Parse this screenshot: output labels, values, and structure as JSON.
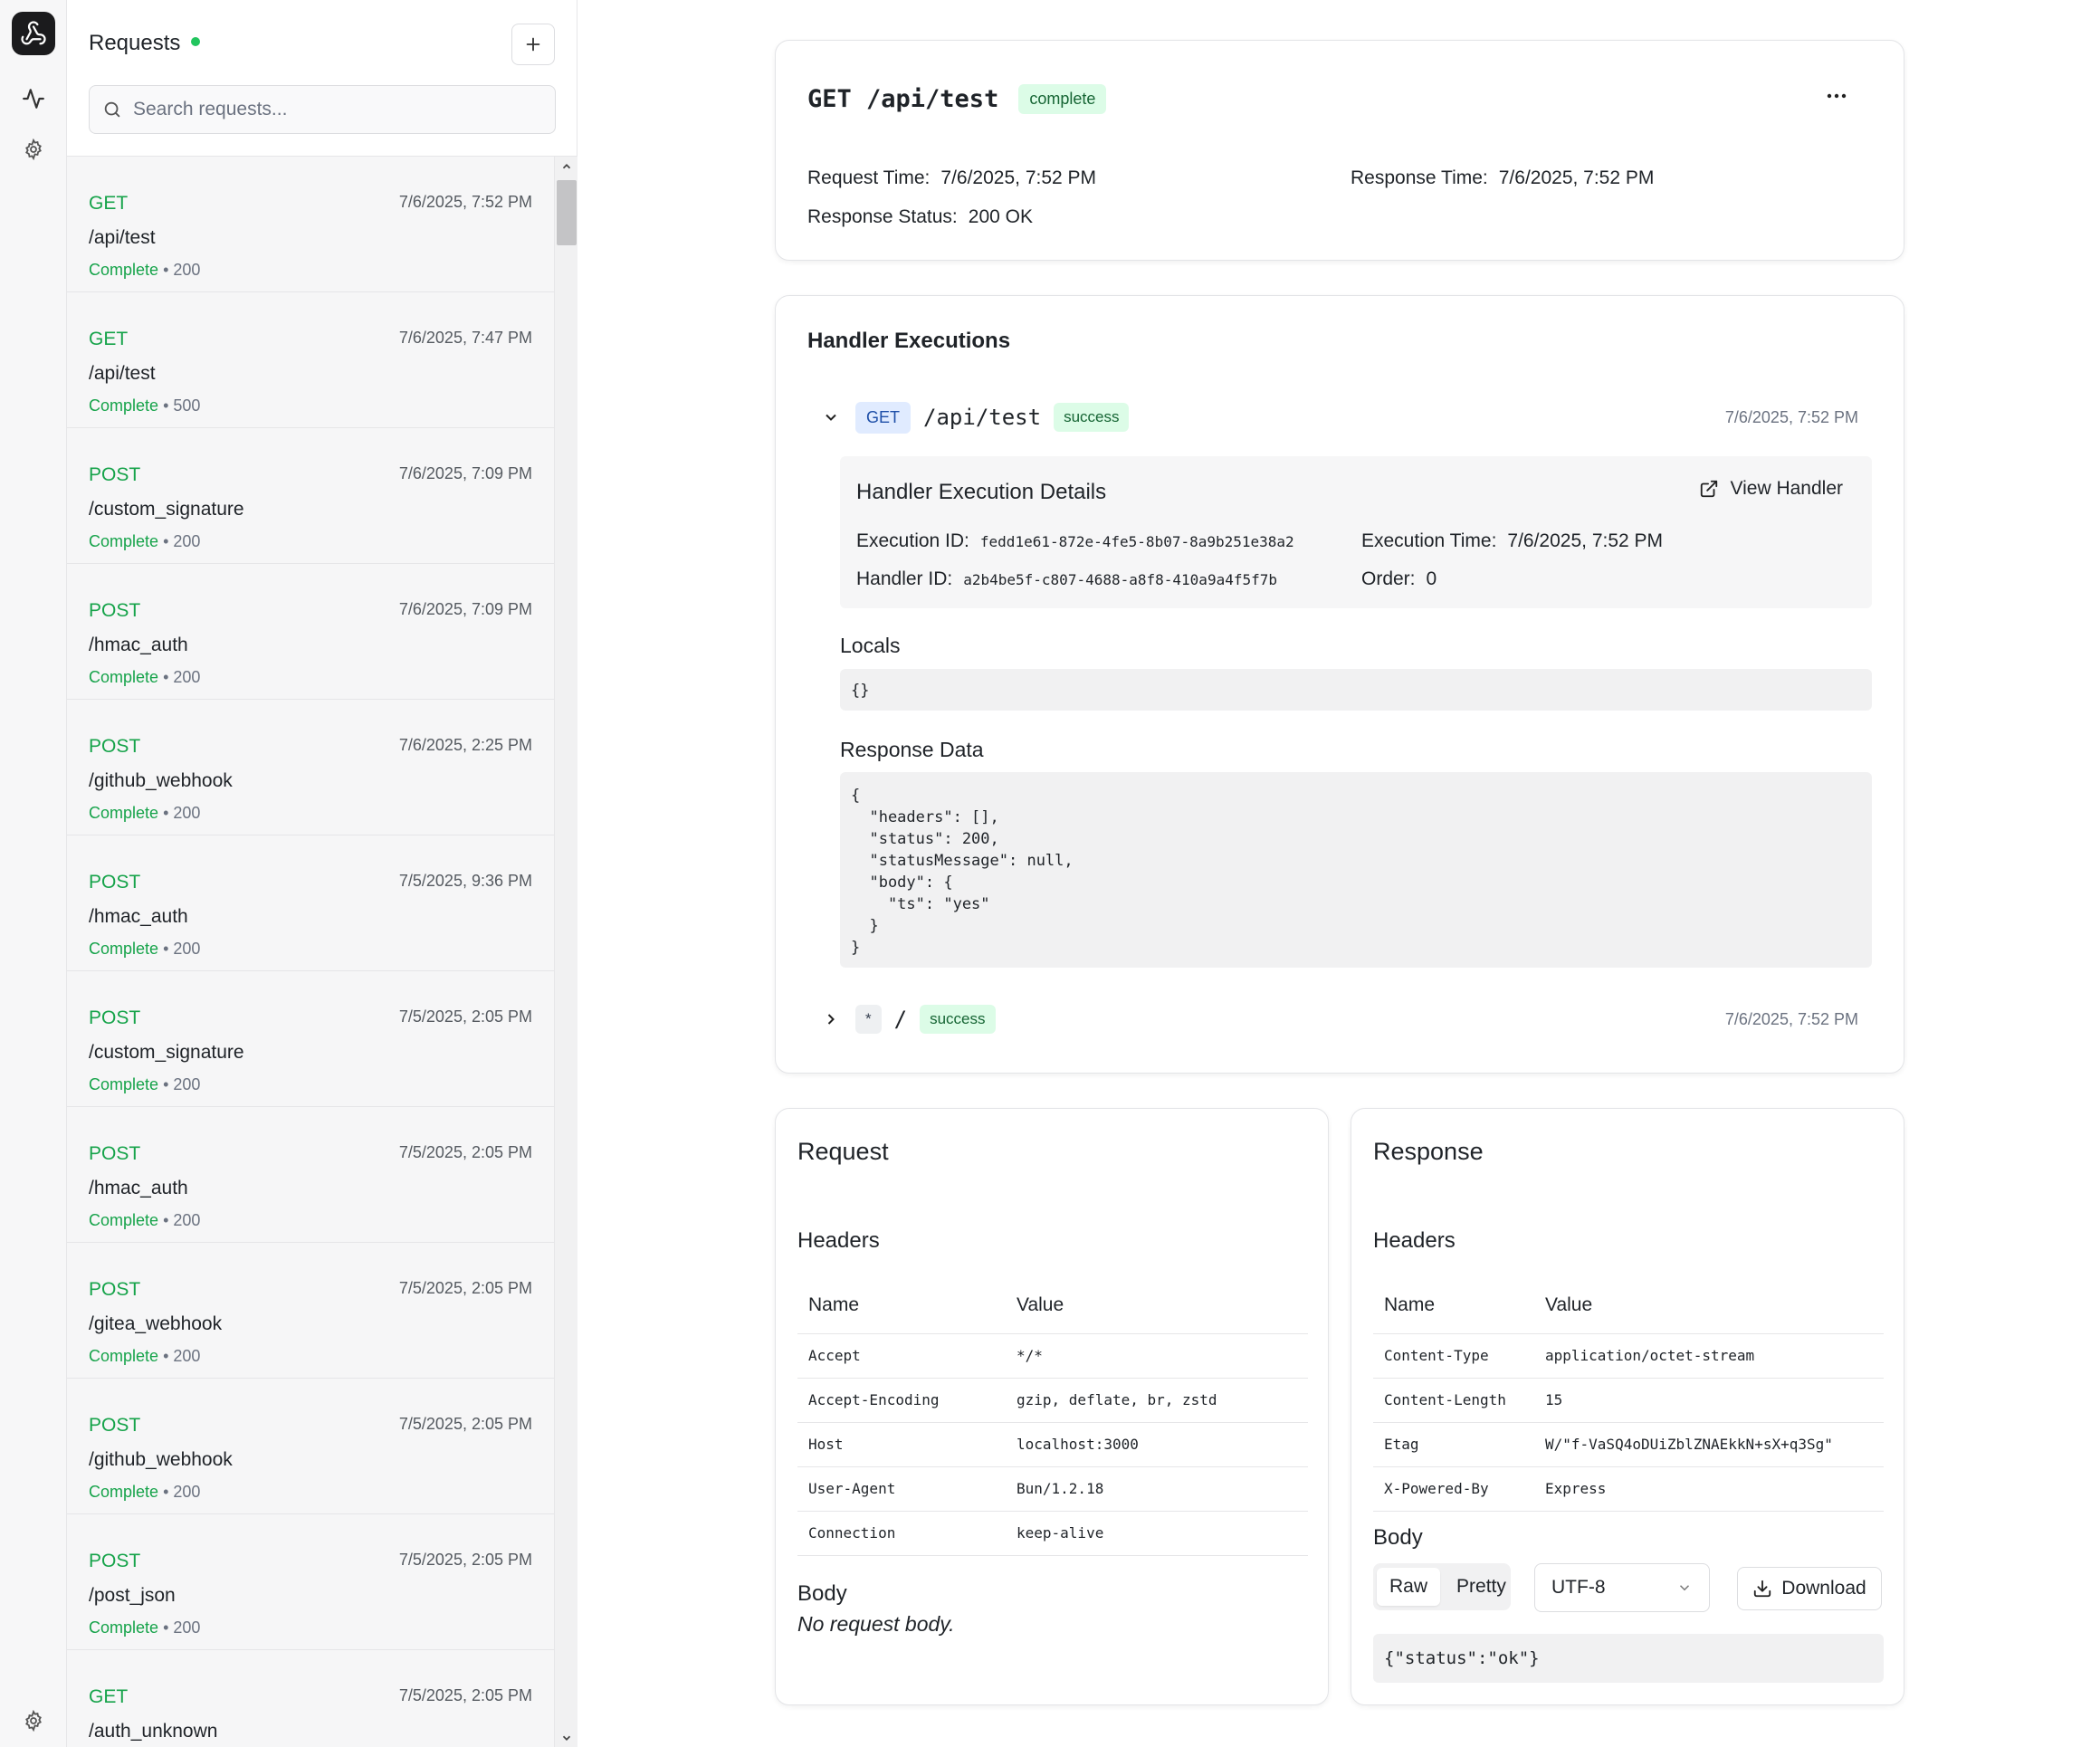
{
  "rail": {
    "icons": [
      "logo-webhook-icon",
      "activity-icon",
      "settings-icon",
      "gear-icon"
    ]
  },
  "sidebar": {
    "title": "Requests",
    "status_color": "#22c55e",
    "search_placeholder": "Search requests...",
    "items": [
      {
        "method": "GET",
        "time": "7/6/2025, 7:52 PM",
        "path": "/api/test",
        "status": "Complete",
        "code": "• 200"
      },
      {
        "method": "GET",
        "time": "7/6/2025, 7:47 PM",
        "path": "/api/test",
        "status": "Complete",
        "code": "• 500"
      },
      {
        "method": "POST",
        "time": "7/6/2025, 7:09 PM",
        "path": "/custom_signature",
        "status": "Complete",
        "code": "• 200"
      },
      {
        "method": "POST",
        "time": "7/6/2025, 7:09 PM",
        "path": "/hmac_auth",
        "status": "Complete",
        "code": "• 200"
      },
      {
        "method": "POST",
        "time": "7/6/2025, 2:25 PM",
        "path": "/github_webhook",
        "status": "Complete",
        "code": "• 200"
      },
      {
        "method": "POST",
        "time": "7/5/2025, 9:36 PM",
        "path": "/hmac_auth",
        "status": "Complete",
        "code": "• 200"
      },
      {
        "method": "POST",
        "time": "7/5/2025, 2:05 PM",
        "path": "/custom_signature",
        "status": "Complete",
        "code": "• 200"
      },
      {
        "method": "POST",
        "time": "7/5/2025, 2:05 PM",
        "path": "/hmac_auth",
        "status": "Complete",
        "code": "• 200"
      },
      {
        "method": "POST",
        "time": "7/5/2025, 2:05 PM",
        "path": "/gitea_webhook",
        "status": "Complete",
        "code": "• 200"
      },
      {
        "method": "POST",
        "time": "7/5/2025, 2:05 PM",
        "path": "/github_webhook",
        "status": "Complete",
        "code": "• 200"
      },
      {
        "method": "POST",
        "time": "7/5/2025, 2:05 PM",
        "path": "/post_json",
        "status": "Complete",
        "code": "• 200"
      },
      {
        "method": "GET",
        "time": "7/5/2025, 2:05 PM",
        "path": "/auth_unknown",
        "status": "",
        "code": ""
      }
    ]
  },
  "summary": {
    "title": "GET /api/test",
    "badge": "complete",
    "request_time_label": "Request Time:",
    "request_time": "7/6/2025, 7:52 PM",
    "response_time_label": "Response Time:",
    "response_time": "7/6/2025, 7:52 PM",
    "response_status_label": "Response Status:",
    "response_status": "200 OK"
  },
  "executions": {
    "title": "Handler Executions",
    "rows": [
      {
        "method": "GET",
        "path": "/api/test",
        "status": "success",
        "time": "7/6/2025, 7:52 PM",
        "expanded": true
      },
      {
        "method": "*",
        "path": "/",
        "status": "success",
        "time": "7/6/2025, 7:52 PM",
        "expanded": false
      }
    ],
    "details": {
      "title": "Handler Execution Details",
      "view_handler": "View Handler",
      "execution_id_label": "Execution ID:",
      "execution_id": "fedd1e61-872e-4fe5-8b07-8a9b251e38a2",
      "execution_time_label": "Execution Time:",
      "execution_time": "7/6/2025, 7:52 PM",
      "handler_id_label": "Handler ID:",
      "handler_id": "a2b4be5f-c807-4688-a8f8-410a9a4f5f7b",
      "order_label": "Order:",
      "order": "0"
    },
    "locals_label": "Locals",
    "locals": "{}",
    "response_data_label": "Response Data",
    "response_data": "{\n  \"headers\": [],\n  \"status\": 200,\n  \"statusMessage\": null,\n  \"body\": {\n    \"ts\": \"yes\"\n  }\n}"
  },
  "request": {
    "title": "Request",
    "headers_label": "Headers",
    "col_name": "Name",
    "col_value": "Value",
    "headers": [
      {
        "name": "Accept",
        "value": "*/*"
      },
      {
        "name": "Accept-Encoding",
        "value": "gzip, deflate, br, zstd"
      },
      {
        "name": "Host",
        "value": "localhost:3000"
      },
      {
        "name": "User-Agent",
        "value": "Bun/1.2.18"
      },
      {
        "name": "Connection",
        "value": "keep-alive"
      }
    ],
    "body_label": "Body",
    "no_body": "No request body."
  },
  "response": {
    "title": "Response",
    "headers_label": "Headers",
    "col_name": "Name",
    "col_value": "Value",
    "headers": [
      {
        "name": "Content-Type",
        "value": "application/octet-stream"
      },
      {
        "name": "Content-Length",
        "value": "15"
      },
      {
        "name": "Etag",
        "value": "W/\"f-VaSQ4oDUiZblZNAEkkN+sX+q3Sg\""
      },
      {
        "name": "X-Powered-By",
        "value": "Express"
      }
    ],
    "body_label": "Body",
    "raw": "Raw",
    "pretty": "Pretty",
    "encoding": "UTF-8",
    "download": "Download",
    "body": "{\"status\":\"ok\"}"
  }
}
